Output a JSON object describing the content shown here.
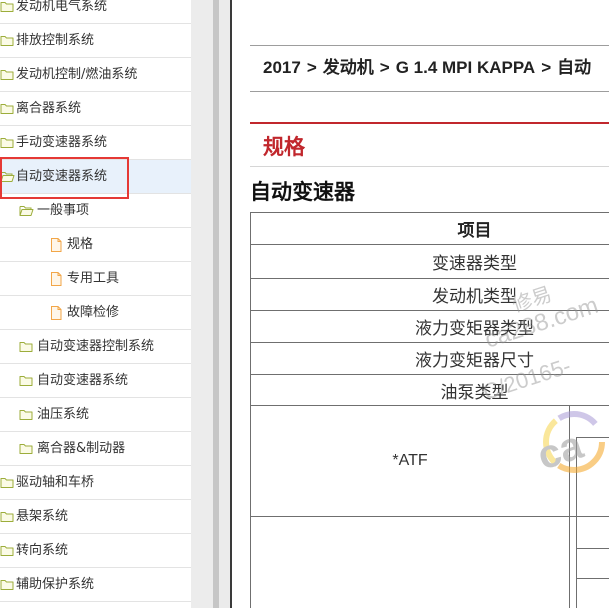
{
  "colors": {
    "selected_row": "#e8f1fb",
    "highlight_box": "#e53935",
    "section_title": "#c1272d",
    "folder_icon": "#9cad3b",
    "file_icon": "#f2a648"
  },
  "tree": {
    "items": [
      {
        "label": "发动机电气系统",
        "level": 0,
        "icon": "folder-icon",
        "selected": false
      },
      {
        "label": "排放控制系统",
        "level": 0,
        "icon": "folder-icon",
        "selected": false
      },
      {
        "label": "发动机控制/燃油系统",
        "level": 0,
        "icon": "folder-icon",
        "selected": false
      },
      {
        "label": "离合器系统",
        "level": 0,
        "icon": "folder-icon",
        "selected": false
      },
      {
        "label": "手动变速器系统",
        "level": 0,
        "icon": "folder-icon",
        "selected": false
      },
      {
        "label": "自动变速器系统",
        "level": 0,
        "icon": "folder-open-icon",
        "selected": true
      },
      {
        "label": "一般事项",
        "level": 1,
        "icon": "folder-open-icon",
        "selected": false
      },
      {
        "label": "规格",
        "level": 2,
        "icon": "file-icon",
        "selected": false
      },
      {
        "label": "专用工具",
        "level": 2,
        "icon": "file-icon",
        "selected": false
      },
      {
        "label": "故障检修",
        "level": 2,
        "icon": "file-icon",
        "selected": false
      },
      {
        "label": "自动变速器控制系统",
        "level": 1,
        "icon": "folder-icon",
        "selected": false
      },
      {
        "label": "自动变速器系统",
        "level": 1,
        "icon": "folder-icon",
        "selected": false
      },
      {
        "label": "油压系统",
        "level": 1,
        "icon": "folder-icon",
        "selected": false
      },
      {
        "label": "离合器&制动器",
        "level": 1,
        "icon": "folder-icon",
        "selected": false
      },
      {
        "label": "驱动轴和车桥",
        "level": 0,
        "icon": "folder-icon",
        "selected": false
      },
      {
        "label": "悬架系统",
        "level": 0,
        "icon": "folder-icon",
        "selected": false
      },
      {
        "label": "转向系统",
        "level": 0,
        "icon": "folder-icon",
        "selected": false
      },
      {
        "label": "辅助保护系统",
        "level": 0,
        "icon": "folder-icon",
        "selected": false
      }
    ]
  },
  "document": {
    "breadcrumb": {
      "parts": [
        "2017",
        "发动机",
        "G 1.4 MPI KAPPA",
        "自动"
      ],
      "separator": ">"
    },
    "section_title": "规格",
    "subsection_title": "自动变速器",
    "table": {
      "header": "项目",
      "rows": [
        "变速器类型",
        "发动机类型",
        "液力变矩器类型",
        "液力变矩器尺寸",
        "油泵类型"
      ],
      "atf_label": "*ATF"
    }
  },
  "watermark": {
    "lines": [
      "修易",
      "ca288.com",
      "C/20165-"
    ],
    "logo_text": "ca"
  }
}
